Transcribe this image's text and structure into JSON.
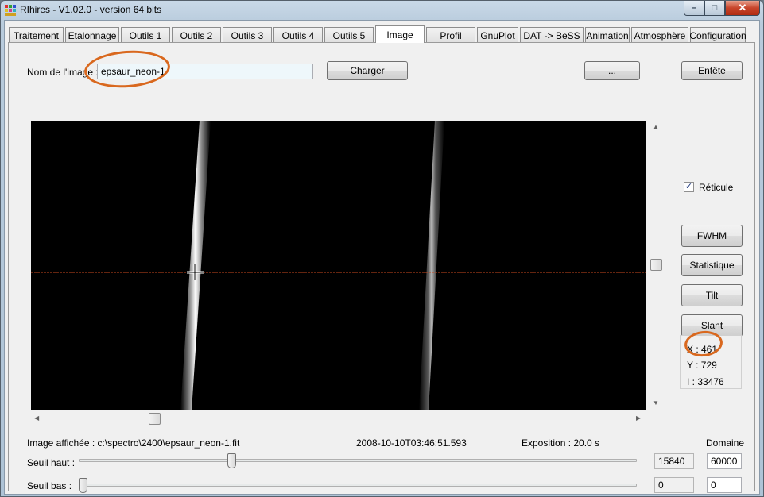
{
  "window": {
    "title": "RIhires - V1.02.0 - version 64 bits",
    "controls": {
      "minimize": "–",
      "maximize": "□",
      "close": "✕"
    }
  },
  "tabs": [
    {
      "label": "Traitement",
      "active": false
    },
    {
      "label": "Etalonnage",
      "active": false
    },
    {
      "label": "Outils 1",
      "active": false
    },
    {
      "label": "Outils 2",
      "active": false
    },
    {
      "label": "Outils 3",
      "active": false
    },
    {
      "label": "Outils 4",
      "active": false
    },
    {
      "label": "Outils 5",
      "active": false
    },
    {
      "label": "Image",
      "active": true
    },
    {
      "label": "Profil",
      "active": false
    },
    {
      "label": "GnuPlot",
      "active": false
    },
    {
      "label": "DAT -> BeSS",
      "active": false
    },
    {
      "label": "Animation",
      "active": false
    },
    {
      "label": "Atmosphère",
      "active": false
    },
    {
      "label": "Configuration",
      "active": false
    }
  ],
  "image_panel": {
    "name_label": "Nom de l'image :",
    "name_value": "epsaur_neon-1",
    "load_button": "Charger",
    "browse_button": "...",
    "header_button": "Entête",
    "reticle_label": "Réticule",
    "reticle_checked": true,
    "fwhm_button": "FWHM",
    "stats_button": "Statistique",
    "tilt_button": "Tilt",
    "slant_button": "Slant",
    "coords": {
      "x": "X : 461",
      "y": "Y : 729",
      "i": "I  : 33476"
    },
    "displayed_image": "Image affichée : c:\\spectro\\2400\\epsaur_neon-1.fit",
    "date": "2008-10-10T03:46:51.593",
    "exposure": "Exposition : 20.0 s",
    "domain_label": "Domaine",
    "high_threshold_label": "Seuil haut :",
    "high_threshold_value": "15840",
    "high_domain_value": "60000",
    "low_threshold_label": "Seuil bas :",
    "low_threshold_value": "0",
    "low_domain_value": "0",
    "high_slider_fraction": 0.27,
    "low_slider_fraction": 0.0
  },
  "colors": {
    "annotation": "#d9681e",
    "crosshair_line": "#c8481e"
  }
}
